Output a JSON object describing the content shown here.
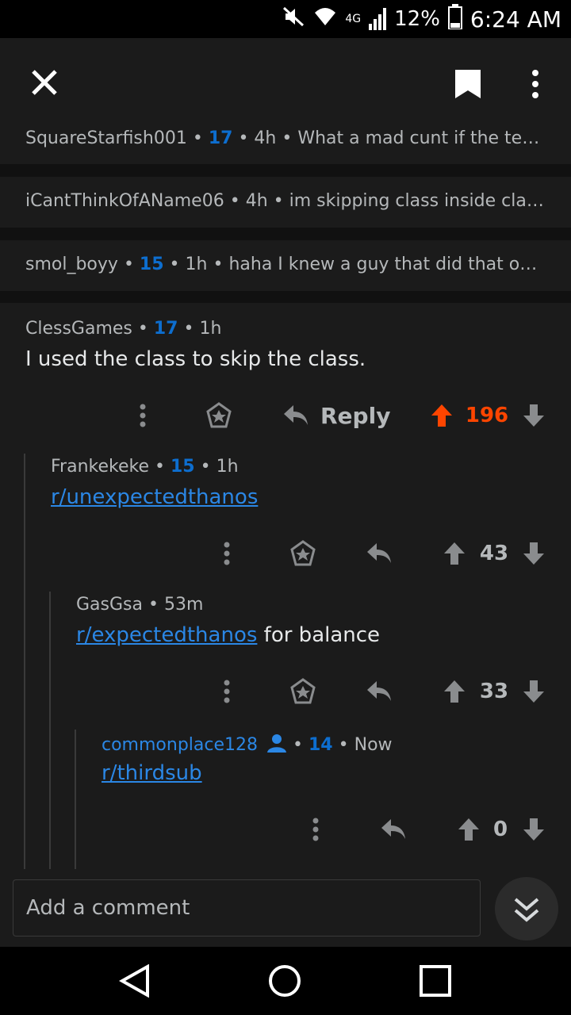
{
  "status_bar": {
    "network": "4G",
    "battery": "12%",
    "time": "6:24 AM"
  },
  "collapsed_comments": [
    {
      "author": "SquareStarfish001",
      "score": "17",
      "time": "4h",
      "preview": "What a mad cunt if the teach..."
    },
    {
      "author": "iCantThinkOfAName06",
      "score": "",
      "time": "4h",
      "preview": "im skipping class inside clas..."
    },
    {
      "author": "smol_boyy",
      "score": "15",
      "time": "1h",
      "preview": "haha I knew a guy that did that once..."
    }
  ],
  "main_comment": {
    "author": "ClessGames",
    "score": "17",
    "time": "1h",
    "body": "I used the class to skip the class.",
    "reply_label": "Reply",
    "votes": "196"
  },
  "replies": [
    {
      "author": "Frankekeke",
      "score": "15",
      "time": "1h",
      "link": "r/unexpectedthanos",
      "text": "",
      "votes": "43"
    },
    {
      "author": "GasGsa",
      "score": "",
      "time": "53m",
      "link": "r/expectedthanos",
      "text": " for balance",
      "votes": "33"
    },
    {
      "author": "commonplace128",
      "score": "14",
      "time": "Now",
      "link": "r/thirdsub",
      "text": "",
      "votes": "0"
    }
  ],
  "composer": {
    "placeholder": "Add a comment"
  },
  "colors": {
    "accent": "#0d6ecf",
    "upvote": "#ff4500",
    "link": "#2b87e5",
    "background": "#1b1b1b"
  }
}
